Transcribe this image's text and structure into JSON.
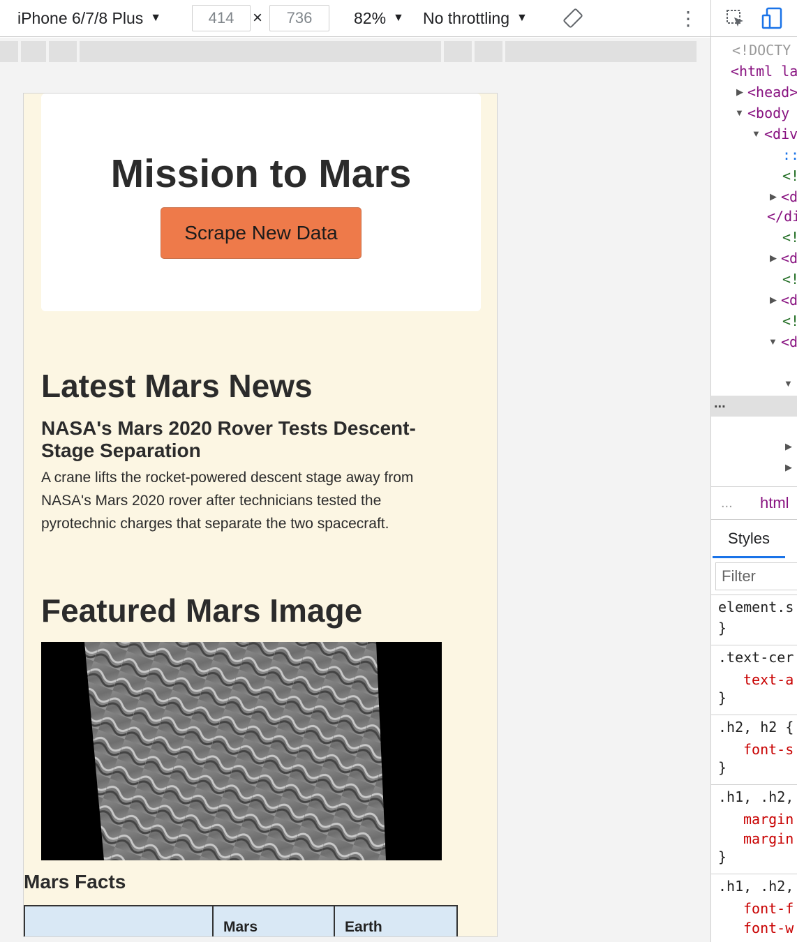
{
  "toolbar": {
    "device": "iPhone 6/7/8 Plus",
    "width": "414",
    "height": "736",
    "times": "×",
    "zoom": "82%",
    "throttling": "No throttling",
    "caret": "▼",
    "more": "⋮"
  },
  "page": {
    "title": "Mission to Mars",
    "scrape_button": "Scrape New Data",
    "news_heading": "Latest Mars News",
    "news_title": "NASA's Mars 2020 Rover Tests Descent-Stage Separation",
    "news_body": "A crane lifts the rocket-powered descent stage away from NASA's Mars 2020 rover after technicians tested the pyrotechnic charges that separate the two spacecraft.",
    "featured_heading": "Featured Mars Image",
    "facts_heading": "Mars Facts",
    "facts_columns": [
      "",
      "Mars",
      "Earth"
    ]
  },
  "devtools": {
    "dom_lines": [
      "<!DOCTY",
      "<html la",
      "<head>",
      "<body",
      "<div",
      "::",
      "<!",
      "<d",
      "</di",
      "<!",
      "<d",
      "<!",
      "<d",
      "<!",
      "<d"
    ],
    "ellipsis": "...",
    "crumb_html": "html",
    "crumb_more": "...",
    "styles_tab": "Styles",
    "filter_placeholder": "Filter",
    "css": {
      "element_sel": "element.s",
      "close": "}",
      "text_center_sel": ".text-cer",
      "text_center_prop": "text-a",
      "h2_sel": ".h2, h2 {",
      "h2_prop": "font-s",
      "h1_sel": ".h1, .h2,",
      "h1_prop1": "margin",
      "h1_prop2": "margin",
      "h1b_sel": ".h1, .h2,",
      "h1b_prop1": "font-f",
      "h1b_prop2": "font-w"
    }
  },
  "colors": {
    "page_bg": "#fcf6e3",
    "button": "#ee7a4a",
    "table_header": "#d9e8f5",
    "accent": "#1a73e8"
  }
}
